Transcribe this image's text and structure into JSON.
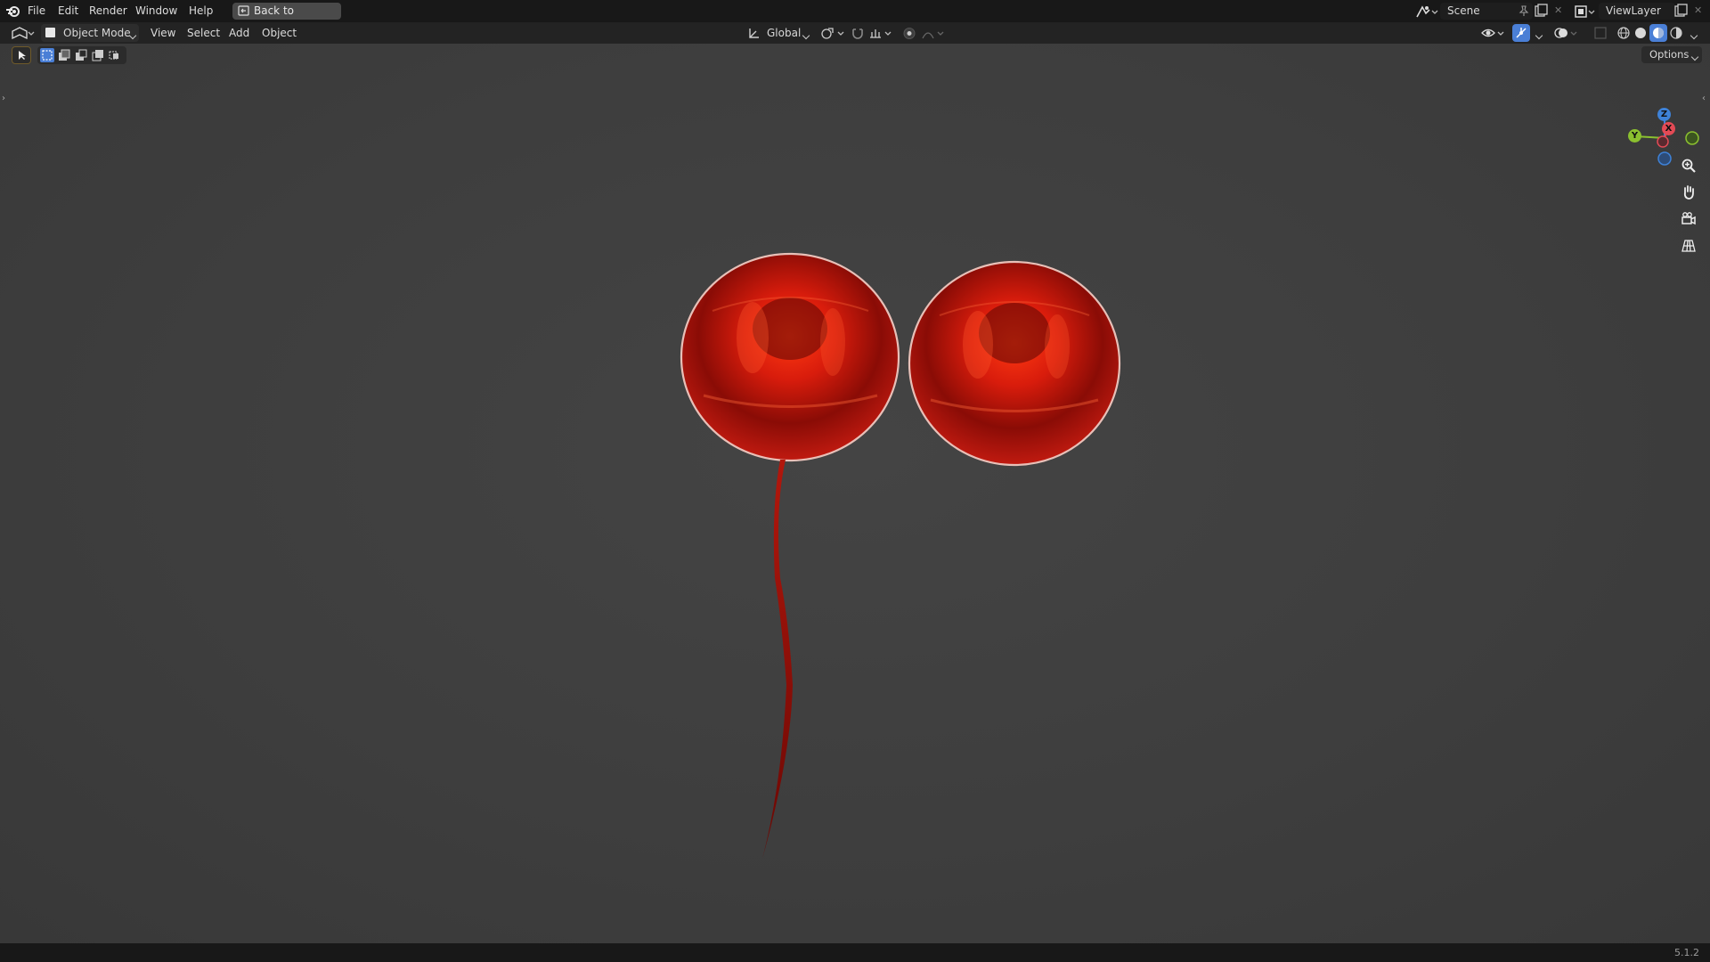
{
  "topbar": {
    "menus": [
      "File",
      "Edit",
      "Render",
      "Window",
      "Help"
    ],
    "back_button": "Back to Previous",
    "scene_name": "Scene",
    "view_layer": "ViewLayer"
  },
  "toolbar": {
    "mode": "Object Mode",
    "menus": [
      "View",
      "Select",
      "Add",
      "Object"
    ],
    "transform_orientation": "Global",
    "options_label": "Options"
  },
  "gizmo": {
    "z_label": "Z",
    "y_label": "Y",
    "x_label": "X"
  },
  "status": {
    "version": "5.1.2"
  },
  "colors": {
    "x_axis": "#e24a55",
    "y_axis": "#8bc02f",
    "z_axis": "#3e82d8",
    "active_shading": "#4a7fd6",
    "balloon_red": "#d81c0c"
  },
  "icons": [
    "blender-logo-icon",
    "editor-type-icon",
    "object-mode-icon",
    "select-box-icon",
    "zoom-icon",
    "hand-icon",
    "camera-icon",
    "grid-icon"
  ]
}
